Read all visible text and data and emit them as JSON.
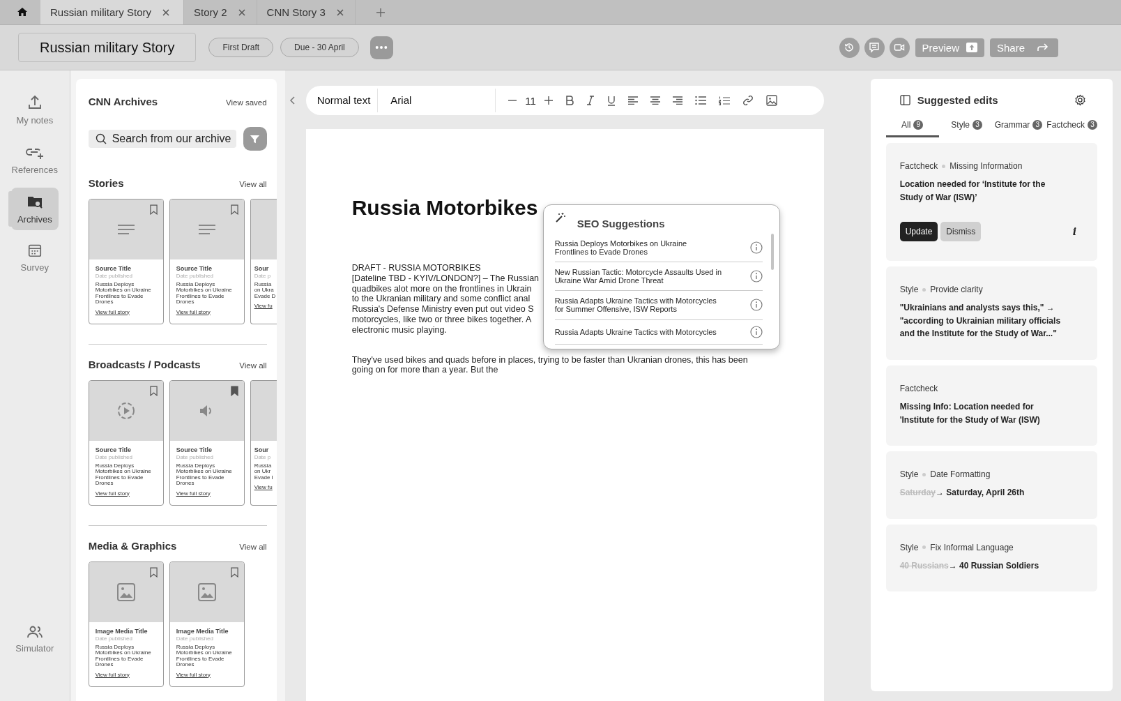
{
  "tabs": [
    {
      "label": "Russian military Story",
      "selected": true
    },
    {
      "label": "Story 2",
      "selected": false
    },
    {
      "label": "CNN Story 3",
      "selected": false
    }
  ],
  "header": {
    "title": "Russian military Story",
    "chips": [
      "First Draft",
      "Due - 30 April"
    ],
    "preview": "Preview",
    "share": "Share"
  },
  "rail": {
    "items": [
      {
        "label": "My notes",
        "kind": "upload",
        "selected": false
      },
      {
        "label": "References",
        "kind": "link",
        "selected": false
      },
      {
        "label": "Archives",
        "kind": "folder",
        "selected": true
      },
      {
        "label": "Survey",
        "kind": "calendar",
        "selected": false
      }
    ],
    "footer": {
      "label": "Simulator",
      "kind": "people",
      "selected": false
    }
  },
  "archives": {
    "title": "CNN Archives",
    "view_saved": "View saved",
    "search_placeholder": "Search from our archive",
    "sections": [
      {
        "title": "Stories",
        "view_all": "View all",
        "cards": [
          {
            "kind": "text",
            "saved": false,
            "title": "Source Title",
            "date": "Date published",
            "desc": "Russia Deploys Motorbikes on Ukraine Frontlines to Evade Drones",
            "link": "View full story"
          },
          {
            "kind": "text",
            "saved": false,
            "title": "Source Title",
            "date": "Date published",
            "desc": "Russia Deploys Motorbikes on Ukraine Frontlines to Evade Drones",
            "link": "View full story"
          },
          {
            "kind": "partial",
            "title": "Sour",
            "date": "Date p",
            "lines": [
              "Russia",
              "on Ukra",
              "Evade D"
            ],
            "link": "View fu"
          }
        ]
      },
      {
        "title": "Broadcasts / Podcasts",
        "view_all": "View all",
        "cards": [
          {
            "kind": "play",
            "saved": false,
            "title": "Source Title",
            "date": "Date published",
            "desc": "Russia Deploys Motorbikes on Ukraine Frontlines to Evade Drones",
            "link": "View full story"
          },
          {
            "kind": "speaker",
            "saved": true,
            "title": "Source Title",
            "date": "Date published",
            "desc": "Russia Deploys Motorbikes on Ukraine Frontlines to Evade Drones",
            "link": "View full story"
          },
          {
            "kind": "partial",
            "title": "Sour",
            "date": "Date p",
            "lines": [
              "Russia",
              "on Ukr",
              "Evade I"
            ],
            "link": "View fu"
          }
        ]
      },
      {
        "title": "Media & Graphics",
        "view_all": "View all",
        "cards": [
          {
            "kind": "image",
            "saved": false,
            "title": "Image Media Title",
            "date": "Date published",
            "desc": "Russia Deploys Motorbikes on Ukraine Frontlines to Evade Drones",
            "link": "View full story"
          },
          {
            "kind": "image",
            "saved": false,
            "title": "Image Media Title",
            "date": "Date published",
            "desc": "Russia Deploys Motorbikes on Ukraine Frontlines to Evade Drones",
            "link": "View full story"
          }
        ]
      }
    ]
  },
  "toolbar": {
    "style": "Normal text",
    "font": "Arial",
    "size": "11"
  },
  "document": {
    "title": "Russia Motorbikes",
    "lines": [
      "DRAFT - RUSSIA MOTORBIKES",
      "[Dateline TBD - KYIV/LONDON?] – The Russian",
      "quadbikes alot more on the frontlines in Ukrain",
      "to the Ukranian military and some conflict anal",
      "Russia's Defense Ministry even put out video S",
      "motorcycles, like two or three bikes together. A",
      "electronic music playing."
    ],
    "paragraph": "They've used bikes and quads before in places, trying to be faster than Ukranian drones, this has been going on for more than a year. But the"
  },
  "seo": {
    "title": "SEO Suggestions",
    "items": [
      "Russia Deploys Motorbikes on Ukraine Frontlines to Evade Drones",
      "New Russian Tactic: Motorcycle Assaults Used in Ukraine War Amid Drone Threat",
      "Russia Adapts Ukraine Tactics with Motorcycles for Summer Offensive, ISW Reports",
      "Russia Adapts Ukraine Tactics with Motorcycles"
    ]
  },
  "suggestions": {
    "title": "Suggested edits",
    "tabs": [
      {
        "label": "All",
        "count": "9",
        "selected": true
      },
      {
        "label": "Style",
        "count": "3",
        "selected": false
      },
      {
        "label": "Grammar",
        "count": "3",
        "selected": false
      },
      {
        "label": "Factcheck",
        "count": "3",
        "selected": false
      }
    ],
    "cards": [
      {
        "category": "Factcheck",
        "subcategory": "Missing Information",
        "text": "Location needed for ‘Institute for the Study of War (ISW)’",
        "actions": [
          "Update",
          "Dismiss"
        ],
        "info": "i"
      },
      {
        "category": "Style",
        "subcategory": "Provide clarity",
        "text": "\"Ukrainians and analysts says this,\" → \"according to Ukrainian military officials and the Institute for the Study of War...\""
      },
      {
        "category": "Factcheck",
        "text": "Missing Info: Location needed for 'Institute for the Study of War (ISW)"
      },
      {
        "category": "Style",
        "subcategory": "Date Formatting",
        "old": "Saturday",
        "new": "→ Saturday, April 26th"
      },
      {
        "category": "Style",
        "subcategory": "Fix Informal Language",
        "old": "40 Russians",
        "new": "→ 40 Russian Soldiers"
      }
    ]
  }
}
